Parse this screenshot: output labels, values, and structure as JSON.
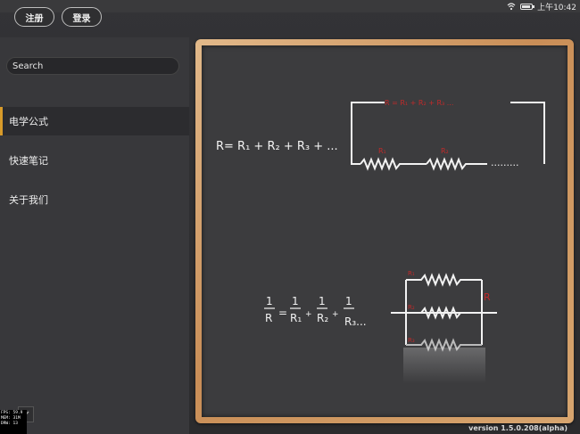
{
  "status_bar": {
    "time": "上午10:42"
  },
  "header": {
    "register_label": "注册",
    "login_label": "登录"
  },
  "sidebar": {
    "search": {
      "value": "Search"
    },
    "items": [
      {
        "label": "电学公式",
        "active": true
      },
      {
        "label": "快速笔记",
        "active": false
      },
      {
        "label": "关于我们",
        "active": false
      }
    ]
  },
  "board": {
    "series": {
      "formula": "R= R₁ + R₂ + R₃ + ...",
      "total_label": "R = R₁ + R₂ + R₃ ...",
      "r1_label": "R₁",
      "r2_label": "R₂",
      "dots": "........."
    },
    "parallel": {
      "formula": {
        "lhs_num": "1",
        "lhs_den": "R",
        "eq": "=",
        "t1_num": "1",
        "t1_den": "R₁",
        "t2_num": "1",
        "t2_den": "R₂",
        "t3_num": "1",
        "t3_den": "R₃...",
        "plus": "+"
      },
      "r1_label": "R₁",
      "r2_label": "R₂",
      "r3_label": "R₃",
      "total_label": "R"
    }
  },
  "debug": {
    "line1": "FPS: 59.9",
    "line2": "MEM: 31M",
    "line3": "DRW: 13"
  },
  "version": "version 1.5.0.208(alpha)",
  "colors": {
    "accent": "#d89b2a",
    "chalk_red": "#c02a2a",
    "chalk_white": "#f2f2f2"
  }
}
